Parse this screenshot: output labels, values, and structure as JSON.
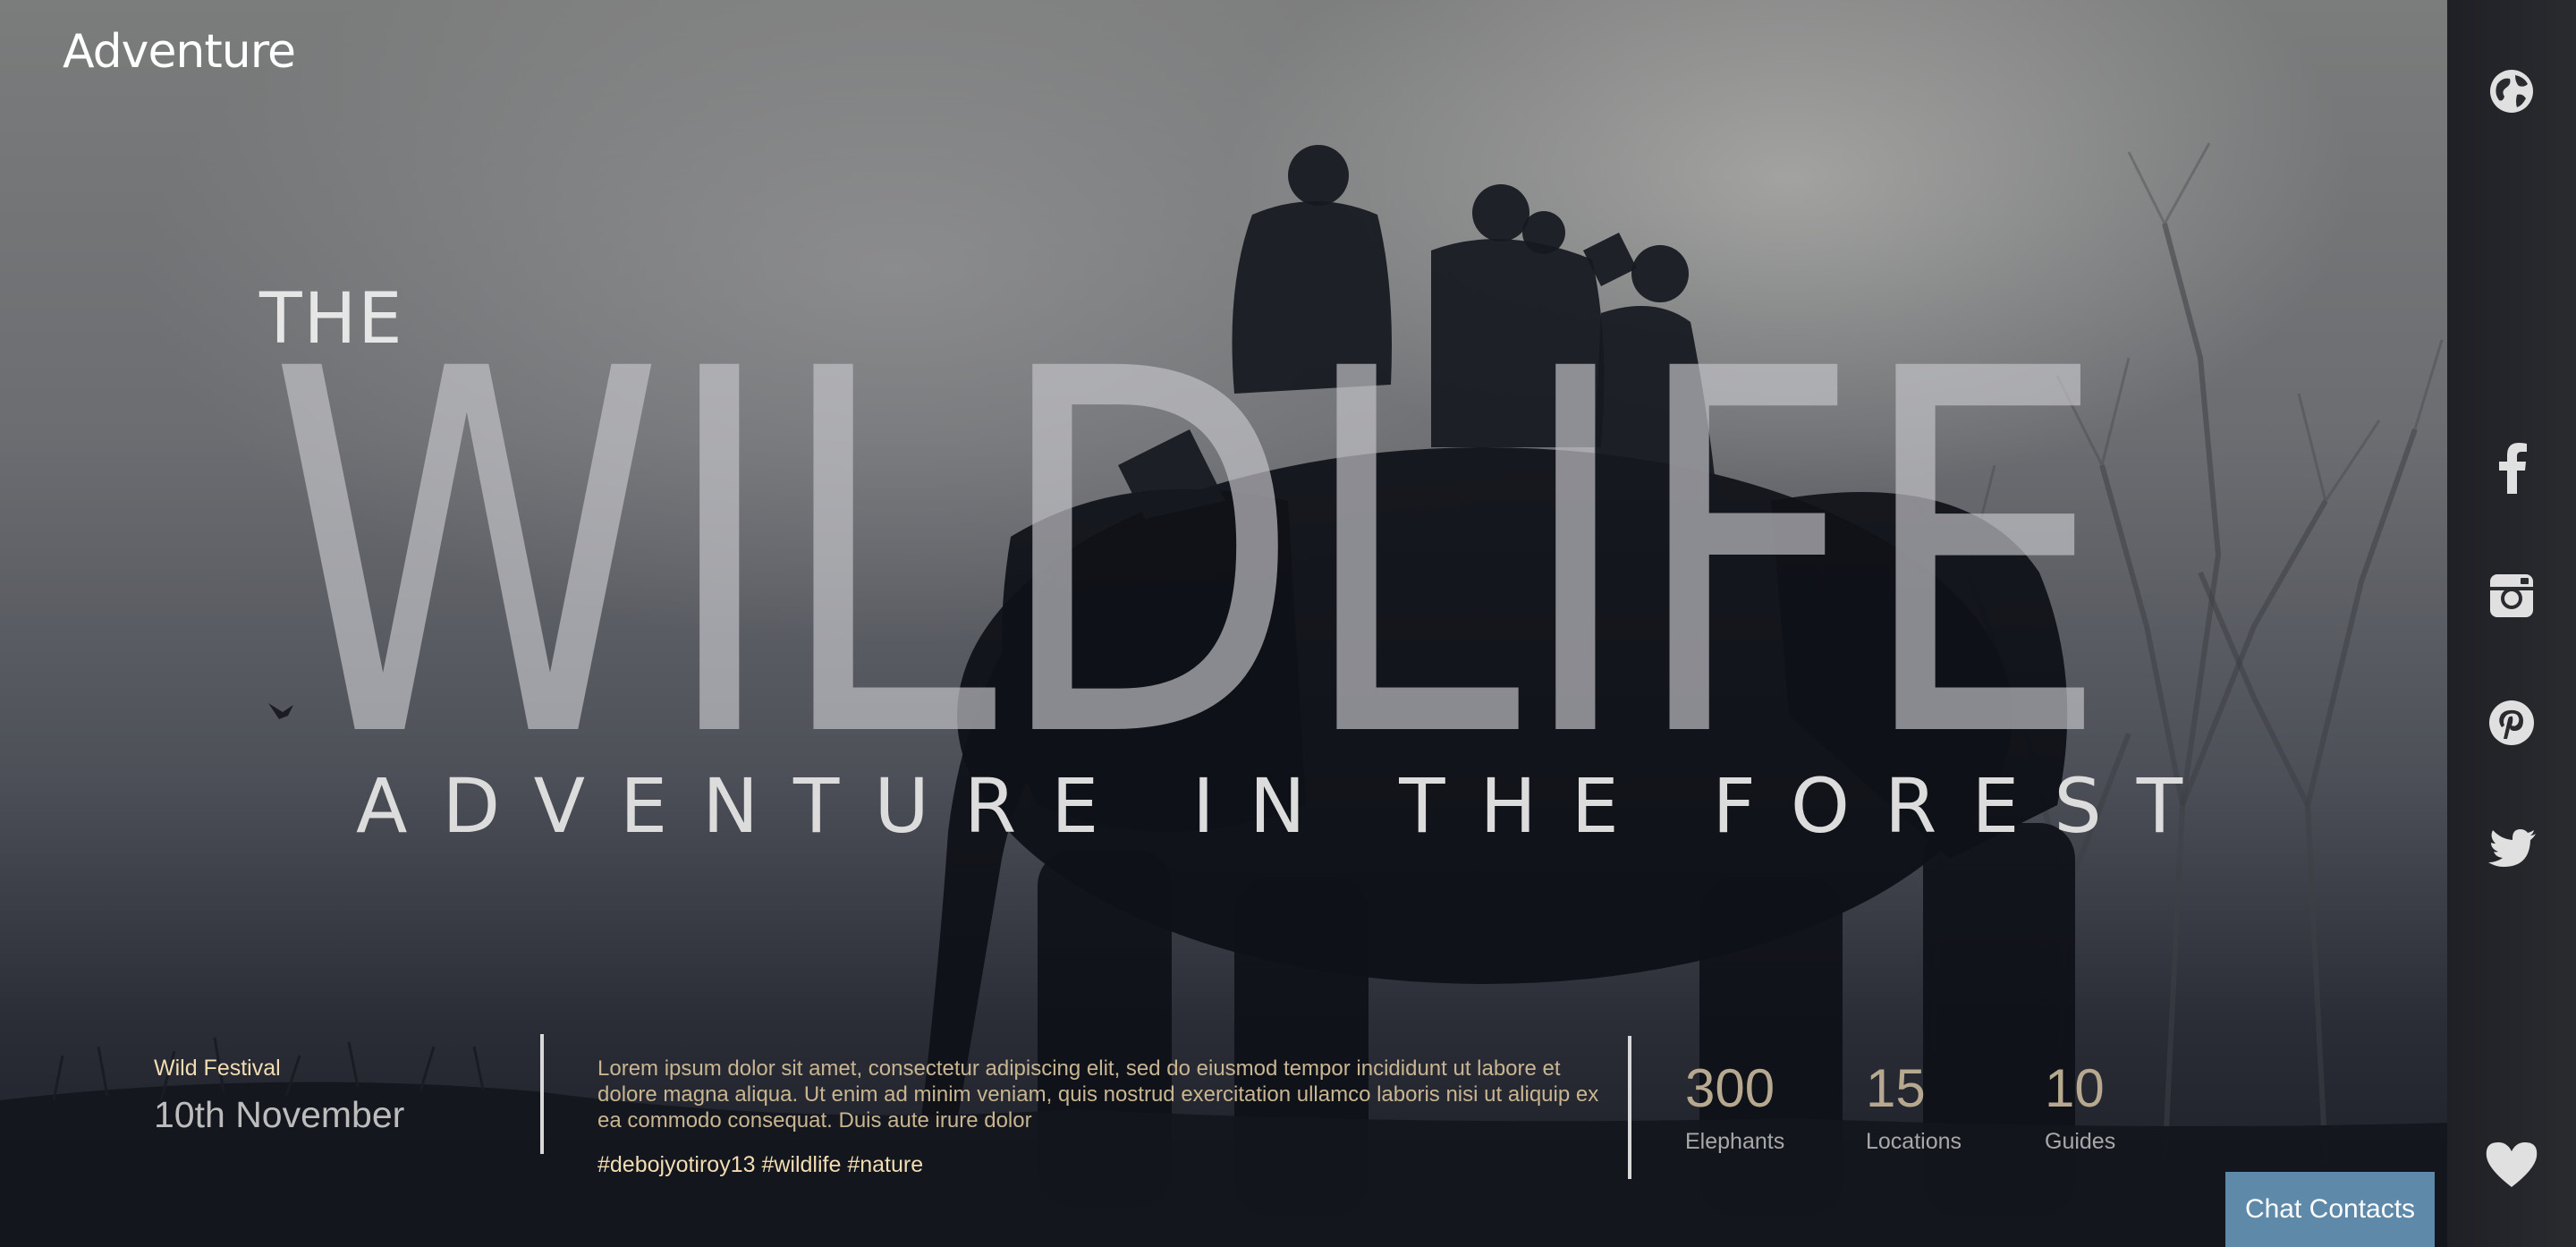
{
  "brand": {
    "logo_text": "Adventure"
  },
  "hero": {
    "pre_title": "THE",
    "title": "WILDLIFE",
    "subtitle": "ADVENTURE IN THE FOREST"
  },
  "event": {
    "label": "Wild Festival",
    "date": "10th November"
  },
  "description": {
    "text": "Lorem ipsum dolor sit amet, consectetur adipiscing elit, sed do eiusmod tempor incididunt ut labore et dolore magna aliqua. Ut enim ad minim veniam, quis nostrud exercitation ullamco laboris nisi ut aliquip ex ea commodo consequat. Duis aute irure dolor",
    "hashtags": "#debojyotiroy13 #wildlife #nature"
  },
  "stats": [
    {
      "value": "300",
      "label": "Elephants"
    },
    {
      "value": "15",
      "label": "Locations"
    },
    {
      "value": "10",
      "label": "Guides"
    }
  ],
  "chat": {
    "label": "Chat Contacts"
  },
  "sidebar": {
    "icons": [
      "globe-icon",
      "facebook-icon",
      "instagram-icon",
      "pinterest-icon",
      "twitter-icon",
      "heart-icon"
    ]
  },
  "colors": {
    "accent": "#f2dcb2",
    "chat_button": "#5e89a8",
    "sidebar_bg": "#25262b"
  }
}
